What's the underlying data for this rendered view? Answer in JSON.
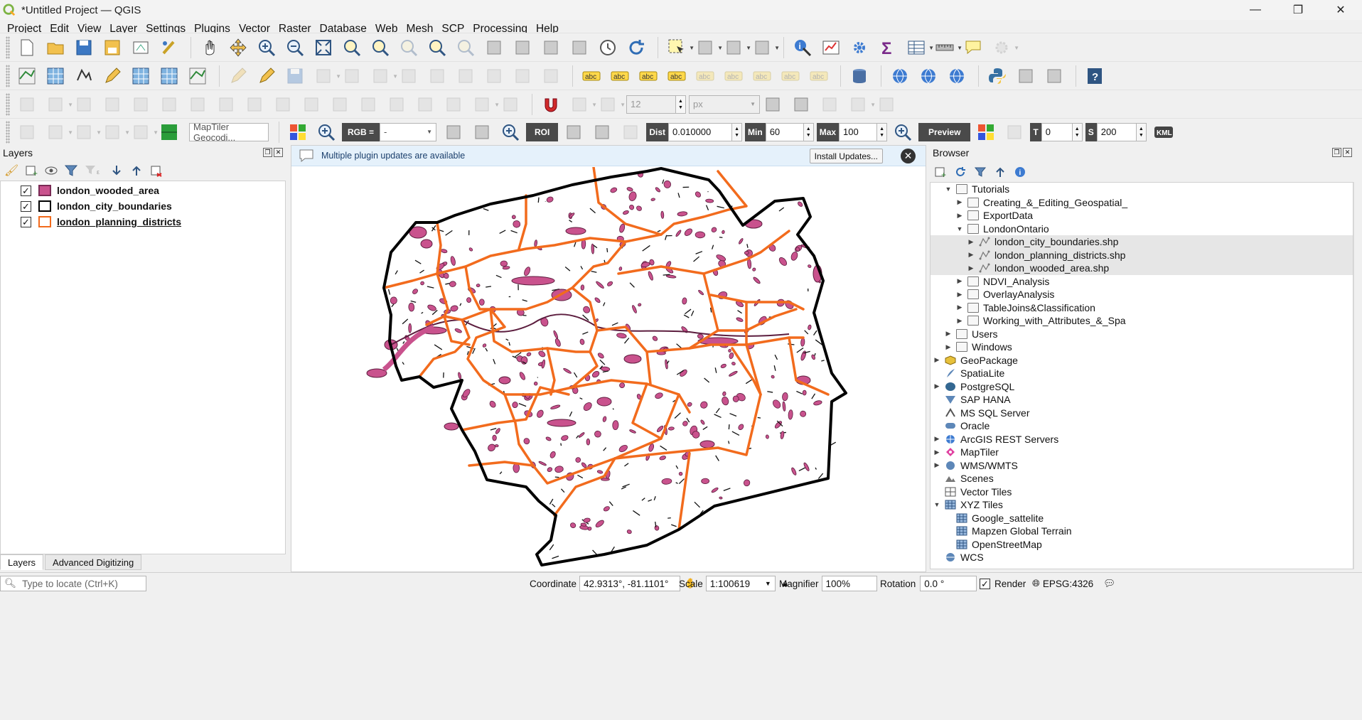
{
  "window": {
    "title": "*Untitled Project — QGIS",
    "controls": {
      "minimize": "—",
      "maximize": "❐",
      "close": "✕"
    }
  },
  "menu": [
    "Project",
    "Edit",
    "View",
    "Layer",
    "Settings",
    "Plugins",
    "Vector",
    "Raster",
    "Database",
    "Web",
    "Mesh",
    "SCP",
    "Processing",
    "Help"
  ],
  "snapping": {
    "tolerance": "12",
    "units": "px"
  },
  "geocoder": {
    "placeholder": "MapTiler Geocodi..."
  },
  "scp": {
    "rgb_label": "RGB =",
    "rgb_value": "-",
    "roi_label": "ROI",
    "dist_label": "Dist",
    "dist_value": "0.010000",
    "min_label": "Min",
    "min_value": "60",
    "max_label": "Max",
    "max_value": "100",
    "preview_label": "Preview",
    "t_label": "T",
    "t_value": "0",
    "s_label": "S",
    "s_value": "200",
    "kml_label": "KML"
  },
  "layers_panel": {
    "title": "Layers",
    "layers": [
      {
        "name": "london_wooded_area",
        "checked": true,
        "swatch_fill": "#c9528d",
        "swatch_stroke": "#7a2a55"
      },
      {
        "name": "london_city_boundaries",
        "checked": true,
        "swatch_fill": "#ffffff",
        "swatch_stroke": "#000000"
      },
      {
        "name": "london_planning_districts",
        "checked": true,
        "swatch_fill": "#ffffff",
        "swatch_stroke": "#f26b1d"
      }
    ],
    "tabs": [
      "Layers",
      "Advanced Digitizing"
    ]
  },
  "message_bar": {
    "text": "Multiple plugin updates are available",
    "button": "Install Updates..."
  },
  "colors": {
    "city_boundary": "#000000",
    "planning_districts": "#f26b1d",
    "wooded_area": "#c9528d",
    "wooded_area_stroke": "#5c1d3e"
  },
  "browser_panel": {
    "title": "Browser",
    "items": [
      {
        "label": "Tutorials",
        "indent": 2,
        "arrow": "down",
        "icon": "folder-icon"
      },
      {
        "label": "Creating_&_Editing_Geospatial_",
        "indent": 3,
        "arrow": "right",
        "icon": "folder-icon"
      },
      {
        "label": "ExportData",
        "indent": 3,
        "arrow": "right",
        "icon": "folder-icon"
      },
      {
        "label": "LondonOntario",
        "indent": 3,
        "arrow": "down",
        "icon": "folder-icon"
      },
      {
        "label": "london_city_boundaries.shp",
        "indent": 4,
        "arrow": "right",
        "icon": "shapefile-icon",
        "selected": true
      },
      {
        "label": "london_planning_districts.shp",
        "indent": 4,
        "arrow": "right",
        "icon": "shapefile-icon",
        "selected": true
      },
      {
        "label": "london_wooded_area.shp",
        "indent": 4,
        "arrow": "right",
        "icon": "shapefile-icon",
        "selected": true
      },
      {
        "label": "NDVI_Analysis",
        "indent": 3,
        "arrow": "right",
        "icon": "folder-icon"
      },
      {
        "label": "OverlayAnalysis",
        "indent": 3,
        "arrow": "right",
        "icon": "folder-icon"
      },
      {
        "label": "TableJoins&Classification",
        "indent": 3,
        "arrow": "right",
        "icon": "folder-icon"
      },
      {
        "label": "Working_with_Attributes_&_Spa",
        "indent": 3,
        "arrow": "right",
        "icon": "folder-icon"
      },
      {
        "label": "Users",
        "indent": 2,
        "arrow": "right",
        "icon": "folder-icon"
      },
      {
        "label": "Windows",
        "indent": 2,
        "arrow": "right",
        "icon": "folder-icon"
      },
      {
        "label": "GeoPackage",
        "indent": 1,
        "arrow": "right",
        "icon": "geopackage-icon"
      },
      {
        "label": "SpatiaLite",
        "indent": 1,
        "arrow": "",
        "icon": "spatialite-icon"
      },
      {
        "label": "PostgreSQL",
        "indent": 1,
        "arrow": "right",
        "icon": "postgresql-icon"
      },
      {
        "label": "SAP HANA",
        "indent": 1,
        "arrow": "",
        "icon": "sap-hana-icon"
      },
      {
        "label": "MS SQL Server",
        "indent": 1,
        "arrow": "",
        "icon": "mssql-icon"
      },
      {
        "label": "Oracle",
        "indent": 1,
        "arrow": "",
        "icon": "oracle-icon"
      },
      {
        "label": "ArcGIS REST Servers",
        "indent": 1,
        "arrow": "right",
        "icon": "arcgis-icon"
      },
      {
        "label": "MapTiler",
        "indent": 1,
        "arrow": "right",
        "icon": "maptiler-icon"
      },
      {
        "label": "WMS/WMTS",
        "indent": 1,
        "arrow": "right",
        "icon": "wms-icon"
      },
      {
        "label": "Scenes",
        "indent": 1,
        "arrow": "",
        "icon": "scenes-icon"
      },
      {
        "label": "Vector Tiles",
        "indent": 1,
        "arrow": "",
        "icon": "vector-tiles-icon"
      },
      {
        "label": "XYZ Tiles",
        "indent": 1,
        "arrow": "down",
        "icon": "xyz-tiles-icon"
      },
      {
        "label": "Google_sattelite",
        "indent": 2,
        "arrow": "",
        "icon": "tile-icon"
      },
      {
        "label": "Mapzen Global Terrain",
        "indent": 2,
        "arrow": "",
        "icon": "tile-icon"
      },
      {
        "label": "OpenStreetMap",
        "indent": 2,
        "arrow": "",
        "icon": "tile-icon"
      },
      {
        "label": "WCS",
        "indent": 1,
        "arrow": "",
        "icon": "wcs-icon"
      }
    ]
  },
  "status_bar": {
    "locator_placeholder": "Type to locate (Ctrl+K)",
    "coordinate_label": "Coordinate",
    "coordinate_value": "42.9313°, -81.1101°",
    "scale_label": "Scale",
    "scale_value": "1:100619",
    "magnifier_label": "Magnifier",
    "magnifier_value": "100%",
    "rotation_label": "Rotation",
    "rotation_value": "0.0 °",
    "render_label": "Render",
    "render_checked": true,
    "crs": "EPSG:4326"
  }
}
